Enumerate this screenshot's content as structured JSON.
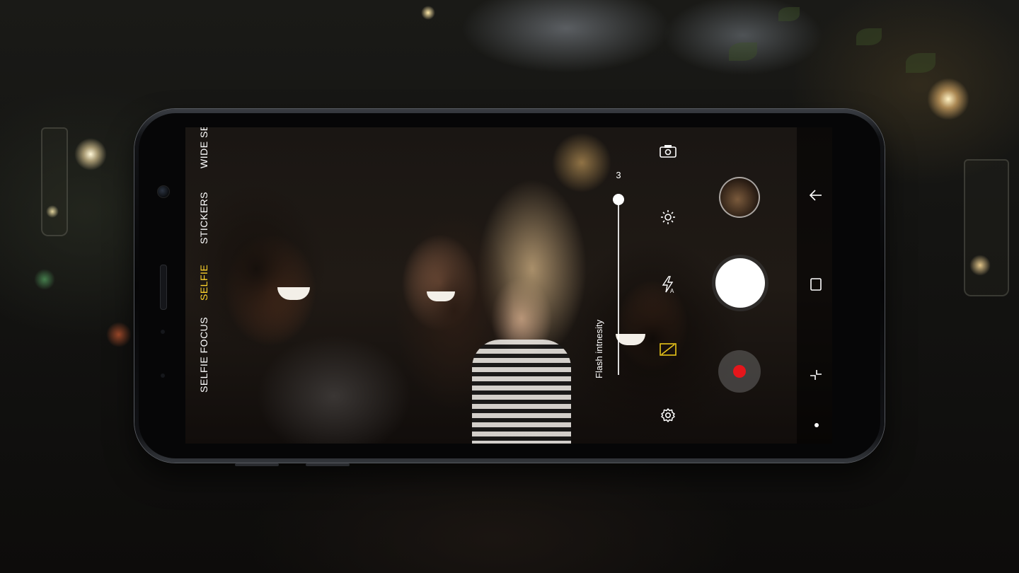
{
  "camera": {
    "modes": [
      {
        "label": "SELFIE FOCUS",
        "active": false
      },
      {
        "label": "SELFIE",
        "active": true
      },
      {
        "label": "STICKERS",
        "active": false
      },
      {
        "label": "WIDE SE",
        "active": false
      }
    ],
    "flash_slider": {
      "value": "3",
      "label": "Flash intnesity"
    },
    "icons": {
      "switch_camera": "switch-camera-icon",
      "brightness": "brightness-icon",
      "flash_auto": "flash-auto-icon",
      "hdr_off": "hdr-off-icon",
      "settings": "settings-gear-icon"
    },
    "buttons": {
      "gallery_thumbnail": "gallery-thumbnail",
      "shutter": "shutter-button",
      "record": "record-button"
    }
  },
  "navigation": {
    "back": "back-arrow-icon",
    "home": "home-square-icon",
    "recents": "recents-icon"
  },
  "colors": {
    "active_mode": "#ffd42b",
    "record": "#e5161b",
    "hdr_icon": "#e8c41a"
  }
}
